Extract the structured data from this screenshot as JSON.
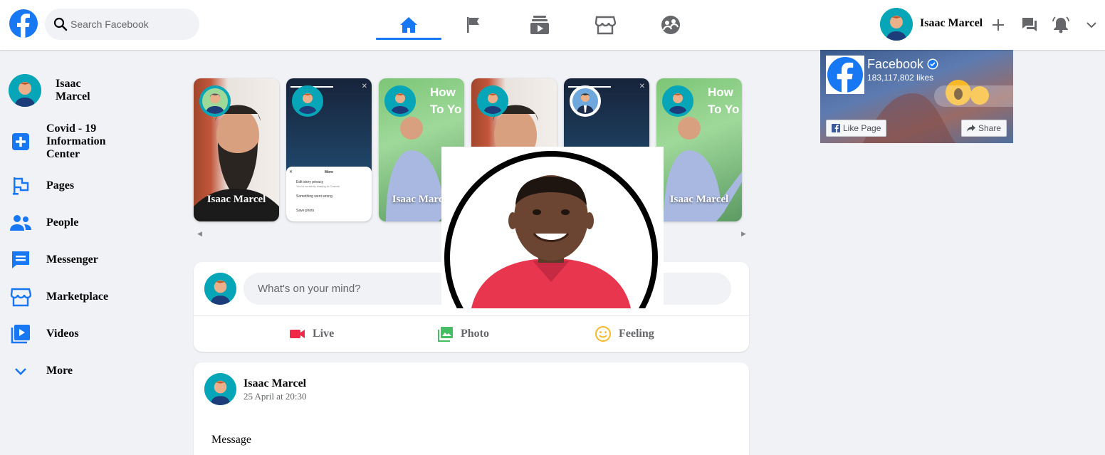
{
  "header": {
    "search_placeholder": "Search Facebook",
    "user_name": "Isaac Marcel",
    "nav_tabs": [
      "home-icon",
      "flag-icon",
      "watch-icon",
      "marketplace-icon",
      "groups-icon"
    ],
    "right_icons": [
      "plus-icon",
      "messenger-icon",
      "bell-icon",
      "chevron-down-icon"
    ]
  },
  "sidebar": {
    "profile_name": "Isaac Marcel",
    "items": [
      {
        "label": "Covid - 19 Information Center",
        "icon": "plus-cross-icon"
      },
      {
        "label": "Pages",
        "icon": "flag-icon"
      },
      {
        "label": "People",
        "icon": "people-icon"
      },
      {
        "label": "Messenger",
        "icon": "chat-icon"
      },
      {
        "label": "Marketplace",
        "icon": "store-icon"
      },
      {
        "label": "Videos",
        "icon": "video-icon"
      },
      {
        "label": "More",
        "icon": "chevron-down-icon"
      }
    ]
  },
  "stories": [
    {
      "name": "Isaac Marcel"
    },
    {
      "name": ""
    },
    {
      "name": "Isaac Marcel"
    },
    {
      "name": ""
    },
    {
      "name": ""
    },
    {
      "name": "Isaac Marcel"
    }
  ],
  "story_text": {
    "green_line1": "How",
    "green_line2": "To Yo",
    "menu_title": "More",
    "menu_item1": "Edit story privacy",
    "menu_item1_sub": "You're currently sharing to Custom",
    "menu_item2": "Something went wrong",
    "menu_item3": "Save photo"
  },
  "composer": {
    "placeholder": "What's on your mind?",
    "actions": [
      {
        "label": "Live",
        "icon": "video-camera-icon",
        "color": "#f02849"
      },
      {
        "label": "Photo",
        "icon": "photo-icon",
        "color": "#45bd62"
      },
      {
        "label": "Feeling",
        "icon": "smile-icon",
        "color": "#f7b928"
      }
    ]
  },
  "post": {
    "author": "Isaac Marcel",
    "time": "25 April at 20:30",
    "message": "Message"
  },
  "page_widget": {
    "title": "Facebook",
    "likes": "183,117,802 likes",
    "like_button": "Like Page",
    "share_button": "Share"
  },
  "colors": {
    "accent": "#1877f2",
    "background": "#f0f2f5"
  }
}
